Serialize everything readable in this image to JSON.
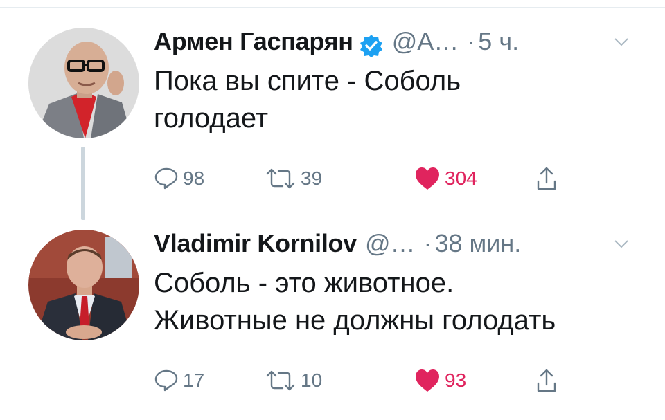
{
  "tweets": [
    {
      "author_name": "Армен Гаспарян",
      "verified": true,
      "handle": "@А…",
      "separator": "·",
      "time": "5 ч.",
      "text_line1": "Пока вы спите - Соболь",
      "text_line2": "голодает",
      "replies": "98",
      "retweets": "39",
      "likes": "304",
      "liked": true
    },
    {
      "author_name": "Vladimir Kornilov",
      "verified": false,
      "handle": "@…",
      "separator": "·",
      "time": "38 мин.",
      "text_line1": "Соболь - это животное.",
      "text_line2": "Животные не должны голодать",
      "replies": "17",
      "retweets": "10",
      "likes": "93",
      "liked": true
    }
  ],
  "colors": {
    "like": "#e0245e",
    "verified": "#1da1f2",
    "secondary_text": "#657786",
    "thread_line": "#ccd6dd"
  },
  "icons": [
    "verified-badge-icon",
    "chevron-down-icon",
    "reply-icon",
    "retweet-icon",
    "heart-icon",
    "share-icon"
  ]
}
